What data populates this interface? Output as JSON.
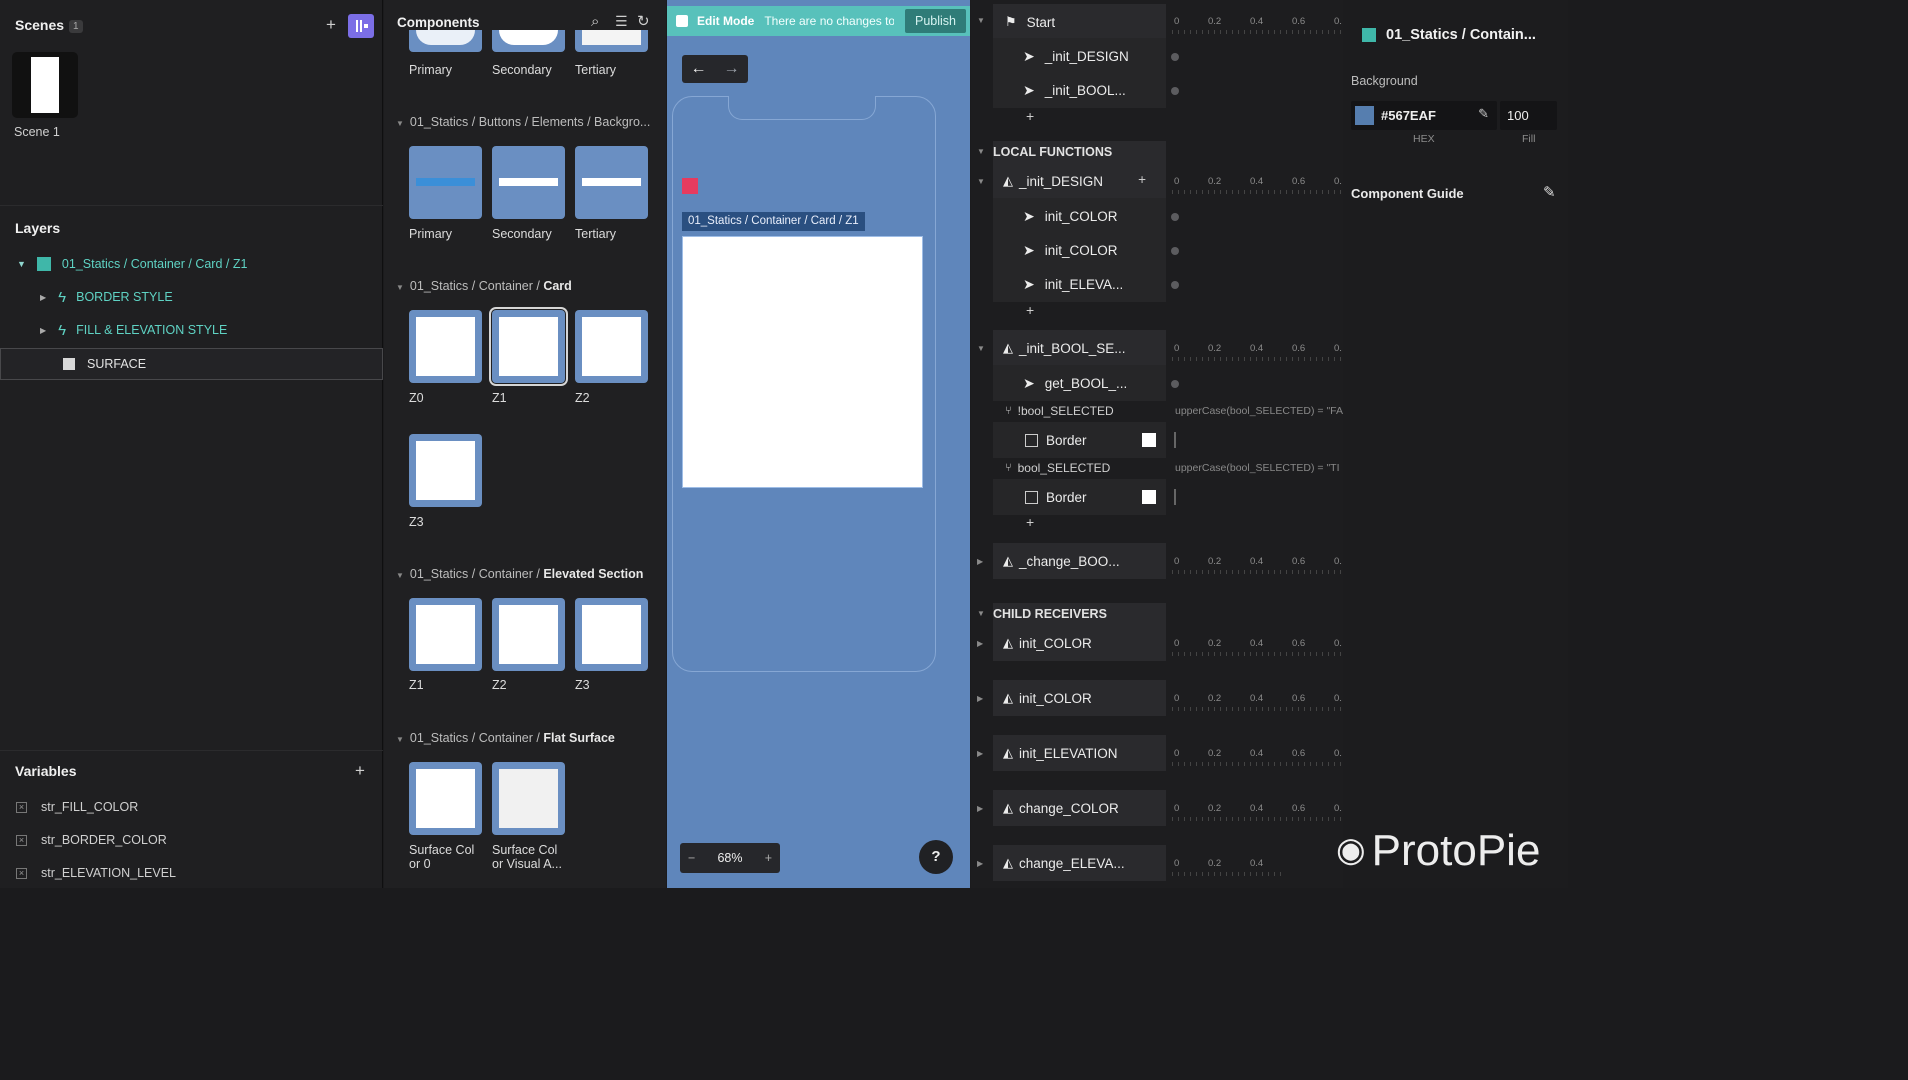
{
  "scenes": {
    "title": "Scenes",
    "count": "1",
    "scene_label": "Scene 1"
  },
  "layers": {
    "title": "Layers",
    "root": "01_Statics / Container / Card / Z1",
    "items": [
      "BORDER STYLE",
      "FILL & ELEVATION STYLE",
      "SURFACE"
    ]
  },
  "variables": {
    "title": "Variables",
    "items": [
      "str_FILL_COLOR",
      "str_BORDER_COLOR",
      "str_ELEVATION_LEVEL"
    ]
  },
  "components": {
    "title": "Components",
    "top_row_labels": [
      "Primary",
      "Secondary",
      "Tertiary"
    ],
    "groups": [
      {
        "path": "01_Statics / Buttons / Elements / Backgro...",
        "bold": "",
        "labels": [
          "Primary",
          "Secondary",
          "Tertiary"
        ]
      },
      {
        "path": "01_Statics / Container / ",
        "bold": "Card",
        "labels": [
          "Z0",
          "Z1",
          "Z2",
          "Z3"
        ]
      },
      {
        "path": "01_Statics / Container / ",
        "bold": "Elevated Section",
        "labels": [
          "Z1",
          "Z2",
          "Z3"
        ]
      },
      {
        "path": "01_Statics / Container / ",
        "bold": "Flat Surface",
        "labels": [
          "Surface Col\nor 0",
          "Surface Col\nor Visual A..."
        ]
      }
    ]
  },
  "canvas": {
    "edit_mode": "Edit Mode",
    "notice": "There are no changes to",
    "publish": "Publish",
    "frame_label": "01_Statics / Container / Card / Z1",
    "zoom": "68%",
    "help": "?"
  },
  "interactions": {
    "start": "Start",
    "start_children": [
      "_init_DESIGN",
      "_init_BOOL..."
    ],
    "local_functions": "LOCAL FUNCTIONS",
    "init_design": "_init_DESIGN",
    "init_design_children": [
      "init_COLOR",
      "init_COLOR",
      "init_ELEVA..."
    ],
    "init_bool": "_init_BOOL_SE...",
    "get_bool": "get_BOOL_...",
    "cond1": "!bool_SELECTED",
    "cond1_expr": "upperCase(bool_SELECTED) = \"FA",
    "cond2": "bool_SELECTED",
    "cond2_expr": "upperCase(bool_SELECTED) = \"TI",
    "border": "Border",
    "change_boo": "_change_BOO...",
    "child_receivers": "CHILD RECEIVERS",
    "receivers": [
      "init_COLOR",
      "init_COLOR",
      "init_ELEVATION",
      "change_COLOR",
      "change_ELEVA..."
    ],
    "ruler_ticks": [
      "0",
      "0.2",
      "0.4",
      "0.6",
      "0."
    ]
  },
  "properties": {
    "title": "01_Statics / Contain...",
    "background_label": "Background",
    "hex_value": "#567EAF",
    "fill_value": "100",
    "hex_caption": "HEX",
    "fill_caption": "Fill",
    "component_guide": "Component Guide",
    "swatch_color": "#567EAF"
  },
  "watermark": "ProtoPie"
}
